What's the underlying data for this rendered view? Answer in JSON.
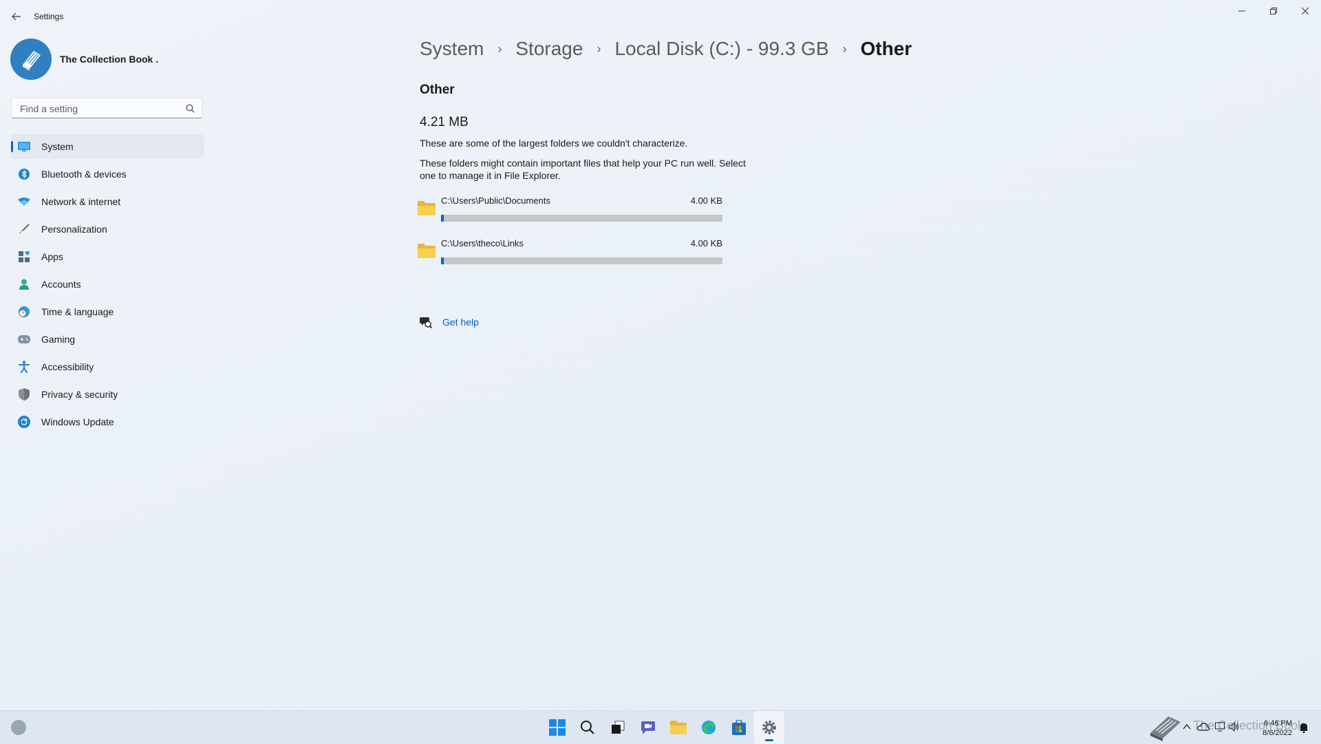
{
  "window": {
    "title": "Settings"
  },
  "profile": {
    "name": "The Collection Book ."
  },
  "search": {
    "placeholder": "Find a setting"
  },
  "sidebar": {
    "items": [
      {
        "label": "System",
        "icon": "system-icon",
        "active": true
      },
      {
        "label": "Bluetooth & devices",
        "icon": "bluetooth-icon"
      },
      {
        "label": "Network & internet",
        "icon": "wifi-icon"
      },
      {
        "label": "Personalization",
        "icon": "brush-icon"
      },
      {
        "label": "Apps",
        "icon": "apps-icon"
      },
      {
        "label": "Accounts",
        "icon": "accounts-icon"
      },
      {
        "label": "Time & language",
        "icon": "globe-clock-icon"
      },
      {
        "label": "Gaming",
        "icon": "gamepad-icon"
      },
      {
        "label": "Accessibility",
        "icon": "accessibility-icon"
      },
      {
        "label": "Privacy & security",
        "icon": "shield-icon"
      },
      {
        "label": "Windows Update",
        "icon": "update-icon"
      }
    ]
  },
  "breadcrumb": {
    "items": [
      "System",
      "Storage",
      "Local Disk (C:) - 99.3 GB",
      "Other"
    ],
    "separator": "›"
  },
  "main": {
    "section_title": "Other",
    "total_size": "4.21 MB",
    "description": "These are some of the largest folders we couldn't characterize.",
    "description2": "These folders might contain important files that help your PC run well. Select one to manage it in File Explorer.",
    "folders": [
      {
        "path": "C:\\Users\\Public\\Documents",
        "size": "4.00 KB",
        "usage_percent": 1
      },
      {
        "path": "C:\\Users\\theco\\Links",
        "size": "4.00 KB",
        "usage_percent": 1
      }
    ],
    "help_label": "Get help"
  },
  "taskbar": {
    "apps": [
      "start-icon",
      "search-icon",
      "task-view-icon",
      "chat-icon",
      "file-explorer-icon",
      "edge-icon",
      "store-icon",
      "settings-icon"
    ],
    "active_app": "settings-icon",
    "watermark": "The Collection Book",
    "time": "6:46 PM",
    "date": "8/6/2022"
  },
  "colors": {
    "accent": "#0067c0",
    "link": "#0060b8",
    "background": "#eef3f9",
    "bar_track": "#c4c6c8"
  }
}
